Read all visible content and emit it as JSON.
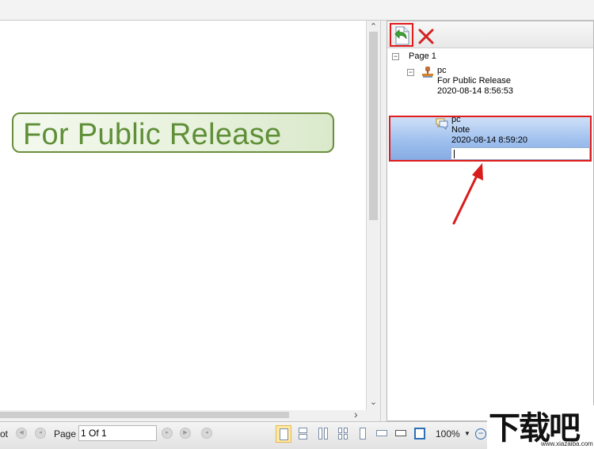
{
  "document": {
    "stamp_text": "For Public Release"
  },
  "annotation_panel": {
    "tree": {
      "page_label": "Page 1",
      "items": [
        {
          "author": "pc",
          "subject": "For Public Release",
          "date": "2020-08-14 8:56:53",
          "icon": "stamp-icon"
        },
        {
          "author": "pc",
          "subject": "Note",
          "date": "2020-08-14 8:59:20",
          "icon": "note-icon",
          "selected": true
        }
      ]
    },
    "reply_input": {
      "value": ""
    }
  },
  "statusbar": {
    "snapshot_fragment": "ot",
    "page_label": "Page",
    "page_value": "1 Of 1",
    "zoom": "100%"
  },
  "watermark": {
    "chinese": "下载吧",
    "domain": "www.xiazaiba.com"
  },
  "colors": {
    "highlight_red": "#e01b1b",
    "stamp_green": "#5f8f38",
    "selection_blue": "#9fc0ee",
    "active_view_button": "#ffe9a6"
  }
}
